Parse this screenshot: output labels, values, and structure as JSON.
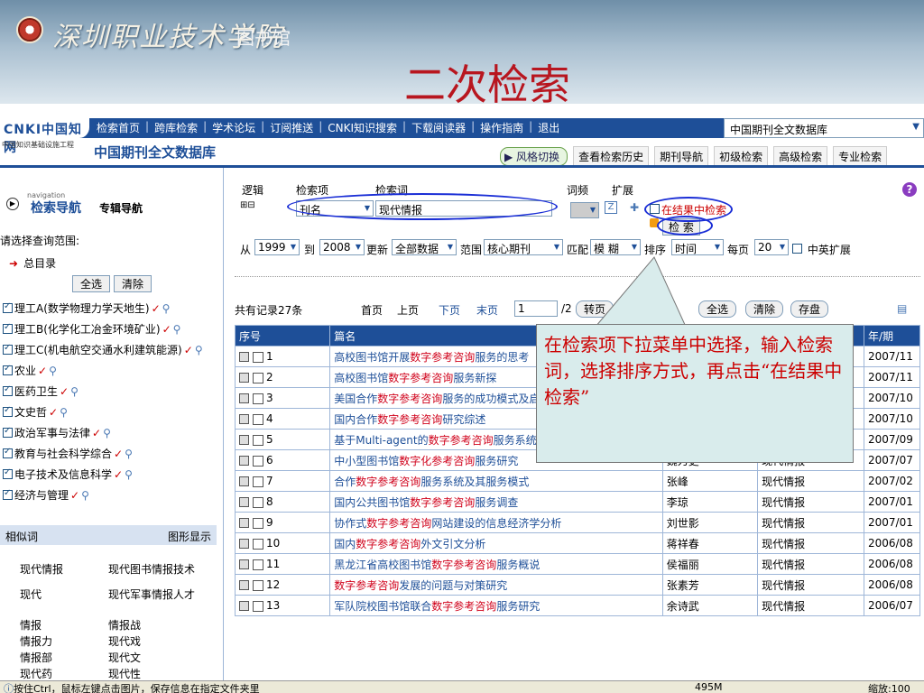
{
  "banner": {
    "school_name": "深圳职业技术学院",
    "library_name": "图书馆",
    "slide_title": "二次检索"
  },
  "navbar": {
    "logo": "CNKI中国知网",
    "logo_url": "www.cnki.net",
    "logo_subtitle": "中国知识基础设施工程",
    "links": [
      "检索首页",
      "跨库检索",
      "学术论坛",
      "订阅推送",
      "CNKI知识搜索",
      "下载阅读器",
      "操作指南",
      "退出"
    ],
    "db_select": "中国期刊全文数据库"
  },
  "db_title": "中国期刊全文数据库",
  "tool_tabs": {
    "style_switch": "风格切换",
    "items": [
      "查看检索历史",
      "期刊导航",
      "初级检索",
      "高级检索",
      "专业检索"
    ]
  },
  "sidebar": {
    "nav_small": "navigation",
    "nav_label": "检索导航",
    "nav_label2": "专辑导航",
    "scope_label": "请选择查询范围:",
    "root": "总目录",
    "select_all": "全选",
    "clear": "清除",
    "categories": [
      "理工A(数学物理力学天地生)",
      "理工B(化学化工冶金环境矿业)",
      "理工C(机电航空交通水利建筑能源)",
      "农业",
      "医药卫生",
      "文史哲",
      "政治军事与法律",
      "教育与社会科学综合",
      "电子技术及信息科学",
      "经济与管理"
    ],
    "related_head": "相似词",
    "graphic": "图形显示",
    "related": [
      [
        "现代情报",
        "现代图书情报技术"
      ],
      [
        "现代",
        "现代军事情报人才"
      ],
      [
        "情报",
        "情报战"
      ],
      [
        "情报力",
        "现代戏"
      ],
      [
        "情报部",
        "现代文"
      ],
      [
        "现代药",
        "现代性"
      ]
    ]
  },
  "search": {
    "logic_label": "逻辑",
    "field_label": "检索项",
    "term_label": "检索词",
    "freq_label": "词频",
    "expand_label": "扩展",
    "logic_icons": "⊞⊟",
    "field_value": "刊名",
    "term_value": "现代情报",
    "in_results_label": "在结果中检索",
    "search_button": "检 索",
    "from_label": "从",
    "year_from": "1999",
    "to_label": "到",
    "year_to": "2008",
    "update_label": "更新",
    "update_value": "全部数据",
    "range_label": "范围",
    "range_value": "核心期刊",
    "match_label": "匹配",
    "match_value": "模 糊",
    "sort_label": "排序",
    "sort_value": "时间",
    "per_page_label": "每页",
    "per_page_value": "20",
    "cn_en_label": "中英扩展"
  },
  "pager": {
    "total": "共有记录27条",
    "first": "首页",
    "prev": "上页",
    "next": "下页",
    "last": "末页",
    "page_value": "1",
    "page_total": "/2",
    "go": "转页",
    "select_all": "全选",
    "clear": "清除",
    "save": "存盘"
  },
  "table": {
    "headers": [
      "序号",
      "篇名",
      "作者",
      "刊名",
      "年/期"
    ],
    "rows": [
      {
        "no": "1",
        "pre": "高校图书馆开展",
        "hl": "数字参考咨询",
        "post": "服务的思考",
        "author": "",
        "journal": "",
        "issue": "2007/11"
      },
      {
        "no": "2",
        "pre": "高校图书馆",
        "hl": "数字参考咨询",
        "post": "服务新探",
        "author": "",
        "journal": "",
        "issue": "2007/11"
      },
      {
        "no": "3",
        "pre": "美国合作",
        "hl": "数字参考咨询",
        "post": "服务的成功模式及启",
        "author": "",
        "journal": "",
        "issue": "2007/10"
      },
      {
        "no": "4",
        "pre": "国内合作",
        "hl": "数字参考咨询",
        "post": "研究综述",
        "author": "",
        "journal": "",
        "issue": "2007/10"
      },
      {
        "no": "5",
        "pre": "基于Multi-agent的",
        "hl": "数字参考咨询",
        "post": "服务系统研究",
        "author": "李海展",
        "journal": "现代情报",
        "issue": "2007/09"
      },
      {
        "no": "6",
        "pre": "中小型图书馆",
        "hl": "数字化参考咨询",
        "post": "服务研究",
        "author": "魏力更",
        "journal": "现代情报",
        "issue": "2007/07"
      },
      {
        "no": "7",
        "pre": "合作",
        "hl": "数字参考咨询",
        "post": "服务系统及其服务模式",
        "author": "张峰",
        "journal": "现代情报",
        "issue": "2007/02"
      },
      {
        "no": "8",
        "pre": "国内公共图书馆",
        "hl": "数字参考咨询",
        "post": "服务调查",
        "author": "李琼",
        "journal": "现代情报",
        "issue": "2007/01"
      },
      {
        "no": "9",
        "pre": "协作式",
        "hl": "数字参考咨询",
        "post": "网站建设的信息经济学分析",
        "author": "刘世影",
        "journal": "现代情报",
        "issue": "2007/01"
      },
      {
        "no": "10",
        "pre": "国内",
        "hl": "数字参考咨询",
        "post": "外文引文分析",
        "author": "蒋祥春",
        "journal": "现代情报",
        "issue": "2006/08"
      },
      {
        "no": "11",
        "pre": "黑龙江省高校图书馆",
        "hl": "数字参考咨询",
        "post": "服务概说",
        "author": "侯福丽",
        "journal": "现代情报",
        "issue": "2006/08"
      },
      {
        "no": "12",
        "pre": "",
        "hl": "数字参考咨询",
        "post": "发展的问题与对策研究",
        "author": "张素芳",
        "journal": "现代情报",
        "issue": "2006/08"
      },
      {
        "no": "13",
        "pre": "军队院校图书馆联合",
        "hl": "数字参考咨询",
        "post": "服务研究",
        "author": "余诗武",
        "journal": "现代情报",
        "issue": "2006/07"
      }
    ]
  },
  "callout": "在检索项下拉菜单中选择，输入检索词，选择排序方式，再点击“在结果中检索”",
  "statusbar": {
    "left": "按住Ctrl，鼠标左键点击图片，保存信息在指定文件夹里",
    "size": "495M",
    "zoom": "缩放:100"
  }
}
